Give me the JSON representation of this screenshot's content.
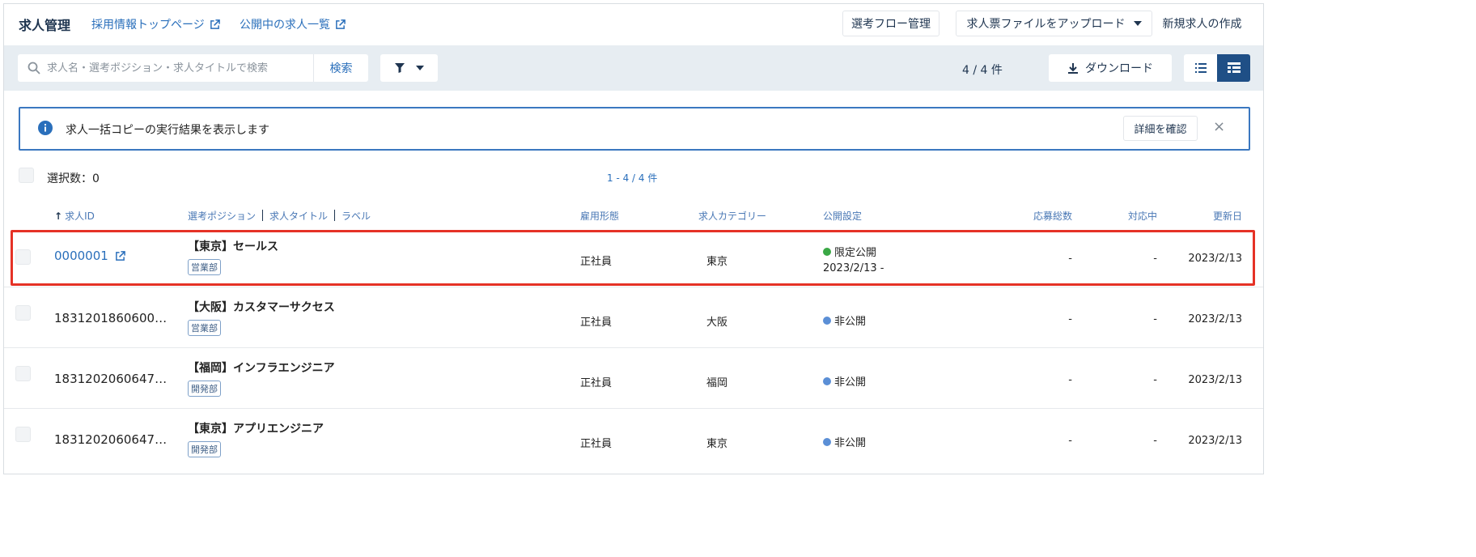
{
  "header": {
    "title": "求人管理",
    "links": [
      "採用情報トップページ",
      "公開中の求人一覧"
    ],
    "flow_button": "選考フロー管理",
    "upload_button": "求人票ファイルをアップロード",
    "create_button": "新規求人の作成"
  },
  "toolbar": {
    "search_placeholder": "求人名・選考ポジション・求人タイトルで検索",
    "search_button": "検索",
    "count": "4 / 4 件",
    "download_button": "ダウンロード"
  },
  "notice": {
    "text": "求人一括コピーの実行結果を表示します",
    "detail_button": "詳細を確認",
    "close": "×"
  },
  "selection": {
    "label": "選択数：0",
    "range": "1 - 4 / 4 件"
  },
  "columns": {
    "id": "求人ID",
    "position": "選考ポジション",
    "job_title": "求人タイトル",
    "label": "ラベル",
    "employment": "雇用形態",
    "category": "求人カテゴリー",
    "publish": "公開設定",
    "applicants": "応募総数",
    "in_progress": "対応中",
    "updated": "更新日"
  },
  "rows": [
    {
      "id": "0000001",
      "title": "【東京】セールス",
      "tag": "営業部",
      "employment": "正社員",
      "category": "東京",
      "status": "限定公開",
      "status_color": "#3aa845",
      "publish_date": "2023/2/13 -",
      "applicants": "-",
      "in_progress": "-",
      "updated": "2023/2/13"
    },
    {
      "id": "1831201860600…",
      "title": "【大阪】カスタマーサクセス",
      "tag": "営業部",
      "employment": "正社員",
      "category": "大阪",
      "status": "非公開",
      "status_color": "#5b8fd6",
      "publish_date": "",
      "applicants": "-",
      "in_progress": "-",
      "updated": "2023/2/13"
    },
    {
      "id": "1831202060647…",
      "title": "【福岡】インフラエンジニア",
      "tag": "開発部",
      "employment": "正社員",
      "category": "福岡",
      "status": "非公開",
      "status_color": "#5b8fd6",
      "publish_date": "",
      "applicants": "-",
      "in_progress": "-",
      "updated": "2023/2/13"
    },
    {
      "id": "1831202060647…",
      "title": "【東京】アプリエンジニア",
      "tag": "開発部",
      "employment": "正社員",
      "category": "東京",
      "status": "非公開",
      "status_color": "#5b8fd6",
      "publish_date": "",
      "applicants": "-",
      "in_progress": "-",
      "updated": "2023/2/13"
    }
  ],
  "colors": {
    "accent": "#2a6fbb",
    "navy": "#1f3550",
    "highlight": "#e53226"
  }
}
